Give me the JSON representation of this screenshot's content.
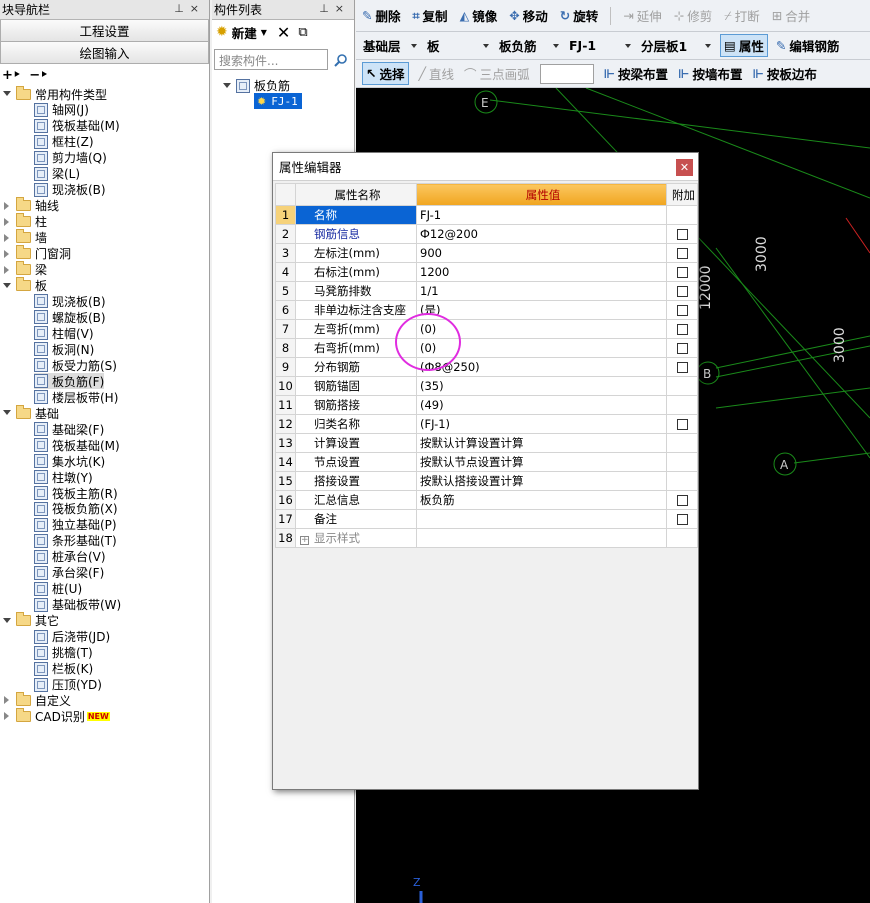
{
  "nav": {
    "title": "块导航栏",
    "btn_settings": "工程设置",
    "btn_input": "绘图输入",
    "tree": [
      {
        "label": "常用构件类型",
        "level": 0,
        "type": "folder",
        "open": true
      },
      {
        "label": "轴网(J)",
        "level": 1,
        "type": "item"
      },
      {
        "label": "筏板基础(M)",
        "level": 1,
        "type": "item"
      },
      {
        "label": "框柱(Z)",
        "level": 1,
        "type": "item"
      },
      {
        "label": "剪力墙(Q)",
        "level": 1,
        "type": "item"
      },
      {
        "label": "梁(L)",
        "level": 1,
        "type": "item"
      },
      {
        "label": "现浇板(B)",
        "level": 1,
        "type": "item"
      },
      {
        "label": "轴线",
        "level": 0,
        "type": "folder",
        "open": false
      },
      {
        "label": "柱",
        "level": 0,
        "type": "folder",
        "open": false
      },
      {
        "label": "墙",
        "level": 0,
        "type": "folder",
        "open": false
      },
      {
        "label": "门窗洞",
        "level": 0,
        "type": "folder",
        "open": false
      },
      {
        "label": "梁",
        "level": 0,
        "type": "folder",
        "open": false
      },
      {
        "label": "板",
        "level": 0,
        "type": "folder",
        "open": true
      },
      {
        "label": "现浇板(B)",
        "level": 1,
        "type": "item"
      },
      {
        "label": "螺旋板(B)",
        "level": 1,
        "type": "item"
      },
      {
        "label": "柱帽(V)",
        "level": 1,
        "type": "item"
      },
      {
        "label": "板洞(N)",
        "level": 1,
        "type": "item"
      },
      {
        "label": "板受力筋(S)",
        "level": 1,
        "type": "item"
      },
      {
        "label": "板负筋(F)",
        "level": 1,
        "type": "item",
        "selected": true
      },
      {
        "label": "楼层板带(H)",
        "level": 1,
        "type": "item"
      },
      {
        "label": "基础",
        "level": 0,
        "type": "folder",
        "open": true
      },
      {
        "label": "基础梁(F)",
        "level": 1,
        "type": "item"
      },
      {
        "label": "筏板基础(M)",
        "level": 1,
        "type": "item"
      },
      {
        "label": "集水坑(K)",
        "level": 1,
        "type": "item"
      },
      {
        "label": "柱墩(Y)",
        "level": 1,
        "type": "item"
      },
      {
        "label": "筏板主筋(R)",
        "level": 1,
        "type": "item"
      },
      {
        "label": "筏板负筋(X)",
        "level": 1,
        "type": "item"
      },
      {
        "label": "独立基础(P)",
        "level": 1,
        "type": "item"
      },
      {
        "label": "条形基础(T)",
        "level": 1,
        "type": "item"
      },
      {
        "label": "桩承台(V)",
        "level": 1,
        "type": "item"
      },
      {
        "label": "承台梁(F)",
        "level": 1,
        "type": "item"
      },
      {
        "label": "桩(U)",
        "level": 1,
        "type": "item"
      },
      {
        "label": "基础板带(W)",
        "level": 1,
        "type": "item"
      },
      {
        "label": "其它",
        "level": 0,
        "type": "folder",
        "open": true
      },
      {
        "label": "后浇带(JD)",
        "level": 1,
        "type": "item"
      },
      {
        "label": "挑檐(T)",
        "level": 1,
        "type": "item"
      },
      {
        "label": "栏板(K)",
        "level": 1,
        "type": "item"
      },
      {
        "label": "压顶(YD)",
        "level": 1,
        "type": "item"
      },
      {
        "label": "自定义",
        "level": 0,
        "type": "folder",
        "open": false
      },
      {
        "label": "CAD识别",
        "level": 0,
        "type": "folder",
        "open": false,
        "badge": "NEW"
      }
    ]
  },
  "complist": {
    "title": "构件列表",
    "new_label": "新建",
    "search_placeholder": "搜索构件...",
    "root": "板负筋",
    "child": "FJ-1"
  },
  "toolbar1": {
    "delete": "删除",
    "copy": "复制",
    "mirror": "镜像",
    "move": "移动",
    "rotate": "旋转",
    "extend": "延伸",
    "trim": "修剪",
    "break": "打断",
    "merge": "合并"
  },
  "toolbar2": {
    "layer": "基础层",
    "type": "板",
    "subtype": "板负筋",
    "name": "FJ-1",
    "floor": "分层板1",
    "prop": "属性",
    "edit_rebar": "编辑钢筋"
  },
  "toolbar3": {
    "select": "选择",
    "line": "直线",
    "arc": "三点画弧",
    "by_beam": "按梁布置",
    "by_wall": "按墙布置",
    "by_edge": "按板边布"
  },
  "canvas": {
    "axis_e": "E",
    "axis_b": "B",
    "axis_a": "A",
    "dim1": "3000",
    "dim2": "12000",
    "dim3": "3000",
    "z": "Z"
  },
  "colors": {
    "grid_line": "#1a8a1a",
    "red_line": "#cc2222",
    "marker": "#e02ce0",
    "accent": "#0a64d4"
  },
  "dialog": {
    "title": "属性编辑器",
    "col_name": "属性名称",
    "col_value": "属性值",
    "col_add": "附加",
    "rows": [
      {
        "num": "1",
        "name": "名称",
        "value": "FJ-1",
        "check": false,
        "selected": true
      },
      {
        "num": "2",
        "name": "钢筋信息",
        "value": "Ф12@200",
        "check": true,
        "blue": true
      },
      {
        "num": "3",
        "name": "左标注(mm)",
        "value": "900",
        "check": true
      },
      {
        "num": "4",
        "name": "右标注(mm)",
        "value": "1200",
        "check": true
      },
      {
        "num": "5",
        "name": "马凳筋排数",
        "value": "1/1",
        "check": true
      },
      {
        "num": "6",
        "name": "非单边标注含支座",
        "value": "(是)",
        "check": true
      },
      {
        "num": "7",
        "name": "左弯折(mm)",
        "value": "(0)",
        "check": true
      },
      {
        "num": "8",
        "name": "右弯折(mm)",
        "value": "(0)",
        "check": true
      },
      {
        "num": "9",
        "name": "分布钢筋",
        "value": "(Ф8@250)",
        "check": true
      },
      {
        "num": "10",
        "name": "钢筋锚固",
        "value": "(35)",
        "check": false
      },
      {
        "num": "11",
        "name": "钢筋搭接",
        "value": "(49)",
        "check": false
      },
      {
        "num": "12",
        "name": "归类名称",
        "value": "(FJ-1)",
        "check": true
      },
      {
        "num": "13",
        "name": "计算设置",
        "value": "按默认计算设置计算",
        "check": false
      },
      {
        "num": "14",
        "name": "节点设置",
        "value": "按默认节点设置计算",
        "check": false
      },
      {
        "num": "15",
        "name": "搭接设置",
        "value": "按默认搭接设置计算",
        "check": false
      },
      {
        "num": "16",
        "name": "汇总信息",
        "value": "板负筋",
        "check": true
      },
      {
        "num": "17",
        "name": "备注",
        "value": "",
        "check": true
      },
      {
        "num": "18",
        "name": "显示样式",
        "value": "",
        "check": false,
        "expandable": true
      }
    ]
  }
}
